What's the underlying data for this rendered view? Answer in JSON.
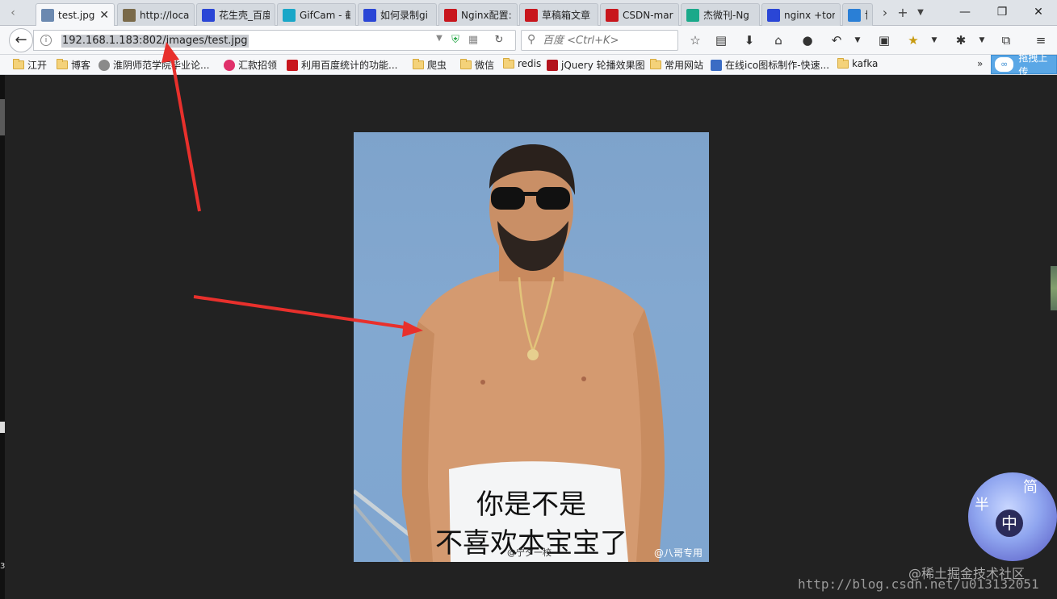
{
  "tabs": [
    {
      "label": "test.jpg",
      "favicon": "image-thumb",
      "color": "#6b89b0",
      "active": true
    },
    {
      "label": "http://loca",
      "favicon": "page-icon",
      "color": "#7a6a4a",
      "active": false
    },
    {
      "label": "花生壳_百度",
      "favicon": "baidu-paw",
      "color": "#2a46d6",
      "active": false
    },
    {
      "label": "GifCam - 截",
      "favicon": "gifcam-icon",
      "color": "#19a7c8",
      "active": false
    },
    {
      "label": "如何录制gi",
      "favicon": "baidu-paw",
      "color": "#2a46d6",
      "active": false
    },
    {
      "label": "Nginx配置:",
      "favicon": "csdn-c",
      "color": "#c8161d",
      "active": false
    },
    {
      "label": "草稿箱文章",
      "favicon": "csdn-c",
      "color": "#c8161d",
      "active": false
    },
    {
      "label": "CSDN-mar",
      "favicon": "csdn-c",
      "color": "#c8161d",
      "active": false
    },
    {
      "label": "杰微刊-Ng",
      "favicon": "jwk-icon",
      "color": "#1aa98a",
      "active": false
    },
    {
      "label": "nginx +tor",
      "favicon": "baidu-paw",
      "color": "#2a46d6",
      "active": false
    },
    {
      "label": "博",
      "favicon": "loading-icon",
      "color": "#2a7fd6",
      "active": false
    }
  ],
  "window": {
    "minimize": "—",
    "maximize": "❐",
    "close": "✕"
  },
  "navbar": {
    "url": "192.168.1.183:802/images/test.jpg",
    "search_placeholder": "百度 <Ctrl+K>"
  },
  "bookmarks": [
    {
      "label": "江开",
      "type": "folder"
    },
    {
      "label": "博客",
      "type": "folder"
    },
    {
      "label": "淮阴师范学院毕业论...",
      "type": "globe"
    },
    {
      "label": "汇款招领",
      "type": "ring"
    },
    {
      "label": "利用百度统计的功能...",
      "type": "csdn"
    },
    {
      "label": "爬虫",
      "type": "folder"
    },
    {
      "label": "微信",
      "type": "folder"
    },
    {
      "label": "redis",
      "type": "folder"
    },
    {
      "label": "jQuery 轮播效果图",
      "type": "jquery"
    },
    {
      "label": "常用网站",
      "type": "folder"
    },
    {
      "label": "在线ico图标制作-快速...",
      "type": "ico"
    },
    {
      "label": "kafka",
      "type": "folder"
    }
  ],
  "bookmarks_more": "»",
  "drag_button": "拖拽上传",
  "image": {
    "caption_line1": "你是不是",
    "caption_line2": "不喜欢本宝宝了",
    "watermark_left": "@宁夕一校",
    "watermark_right": "@八哥专用"
  },
  "seal": {
    "c1": "半",
    "c2": "简",
    "c3": "中"
  },
  "footer": {
    "community": "@稀土掘金技术社区",
    "blog_url": "http://blog.csdn.net/u013132051"
  },
  "left_digit": "3"
}
